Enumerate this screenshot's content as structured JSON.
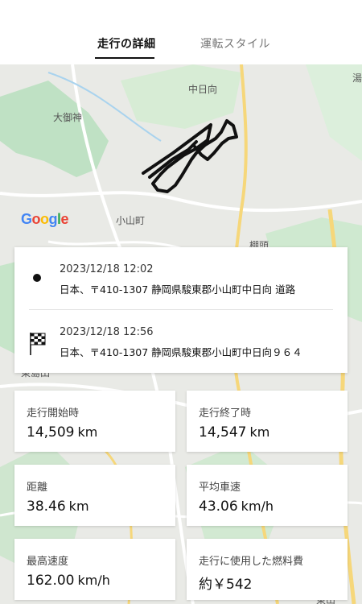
{
  "tabs": [
    {
      "label": "走行の詳細",
      "active": true
    },
    {
      "label": "運転スタイル",
      "active": false
    }
  ],
  "map": {
    "place_labels": [
      "中日向",
      "大御神",
      "小山町",
      "湯",
      "棚頭",
      "東山",
      "東島田"
    ],
    "logo": [
      "G",
      "o",
      "o",
      "g",
      "l",
      "e"
    ],
    "logo_colors": [
      "#4285F4",
      "#EA4335",
      "#FBBC05",
      "#4285F4",
      "#34A853",
      "#EA4335"
    ]
  },
  "route": {
    "start": {
      "time": "2023/12/18 12:02",
      "address": "日本、〒410-1307 静岡県駿東郡小山町中日向 道路",
      "icon": "start-dot-icon"
    },
    "end": {
      "time": "2023/12/18 12:56",
      "address": "日本、〒410-1307 静岡県駿東郡小山町中日向９６４",
      "icon": "checkered-flag-icon"
    }
  },
  "stats": {
    "odo_start": {
      "label": "走行開始時",
      "value": "14,509",
      "unit": "km"
    },
    "odo_end": {
      "label": "走行終了時",
      "value": "14,547",
      "unit": "km"
    },
    "distance": {
      "label": "距離",
      "value": "38.46",
      "unit": "km"
    },
    "avg_speed": {
      "label": "平均車速",
      "value": "43.06",
      "unit": "km/h"
    },
    "max_speed": {
      "label": "最高速度",
      "value": "162.00",
      "unit": "km/h"
    },
    "fuel_cost": {
      "label": "走行に使用した燃料費",
      "value": "約￥542",
      "unit": ""
    }
  }
}
